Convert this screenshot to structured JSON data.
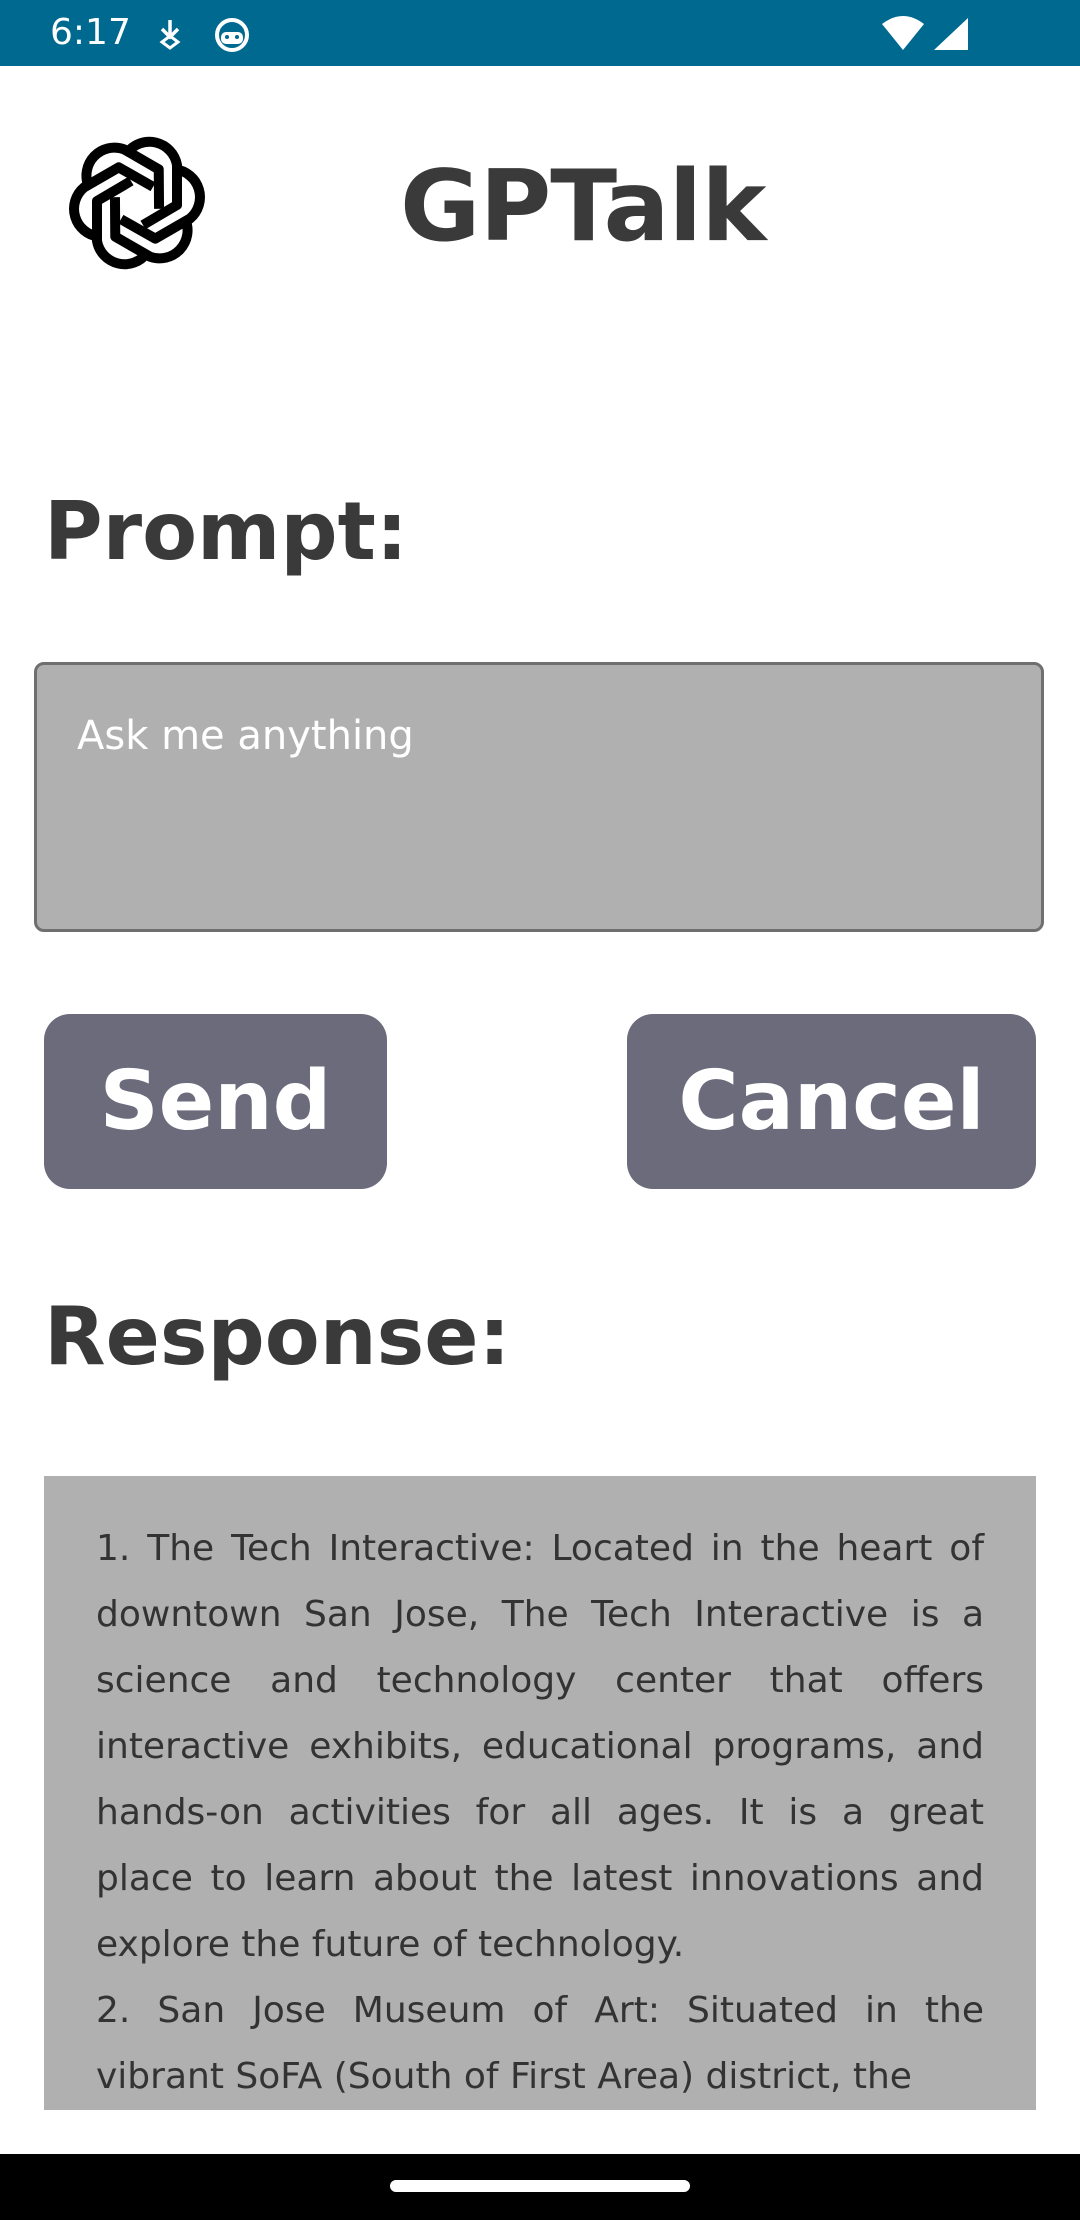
{
  "status_bar": {
    "time": "6:17",
    "icons": [
      "download-icon",
      "android-icon",
      "wifi-icon",
      "signal-icon"
    ],
    "background": "#006990"
  },
  "header": {
    "logo": "openai-logo",
    "title": "GPTalk"
  },
  "prompt": {
    "label": "Prompt:",
    "placeholder": "Ask me anything",
    "value": ""
  },
  "buttons": {
    "send": "Send",
    "cancel": "Cancel",
    "color": "#6b6b7c"
  },
  "response": {
    "label": "Response:",
    "text": "1. The Tech Interactive: Located in the heart of downtown San Jose, The Tech Interactive is a science and technology center that offers interactive exhibits, educational programs, and hands-on activities for all ages. It is a great place to learn about the latest innovations and explore the future of technology.\n2. San Jose Museum of Art: Situated in the vibrant SoFA (South of First Area) district, the"
  }
}
